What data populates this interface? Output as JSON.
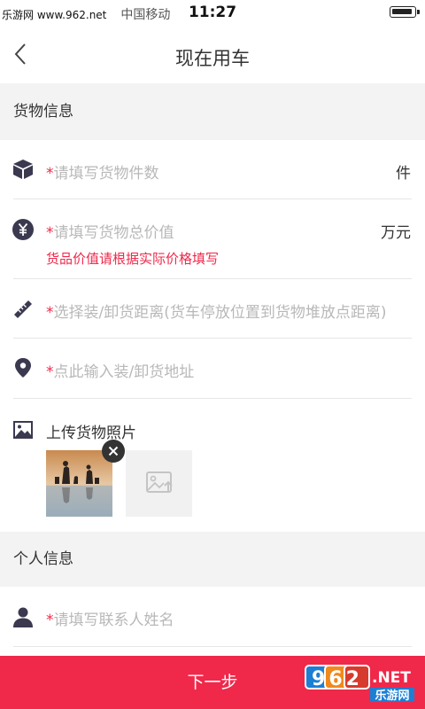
{
  "status_bar": {
    "watermark": "乐游网 www.962.net",
    "carrier": "中国移动",
    "time": "11:27"
  },
  "nav": {
    "title": "现在用车"
  },
  "sections": {
    "cargo_header": "货物信息",
    "personal_header": "个人信息"
  },
  "cargo": {
    "count": {
      "required_mark": "*",
      "placeholder": "请填写货物件数",
      "unit": "件",
      "icon": "box-icon"
    },
    "value": {
      "required_mark": "*",
      "placeholder": "请填写货物总价值",
      "unit": "万元",
      "hint": "货品价值请根据实际价格填写",
      "icon": "yuan-icon"
    },
    "distance": {
      "required_mark": "*",
      "placeholder": "选择装/卸货距离(货车停放位置到货物堆放点距离)",
      "icon": "ruler-icon"
    },
    "address": {
      "required_mark": "*",
      "placeholder": "点此输入装/卸货地址",
      "icon": "location-pin-icon"
    },
    "photos": {
      "label": "上传货物照片",
      "icon": "image-icon"
    }
  },
  "personal": {
    "contact_name": {
      "required_mark": "*",
      "placeholder": "请填写联系人姓名",
      "icon": "person-icon"
    }
  },
  "footer": {
    "next_label": "下一步",
    "logo_number": "962",
    "logo_suffix": ".NET",
    "logo_caption": "乐游网"
  },
  "colors": {
    "accent": "#f0284a",
    "section_bg": "#f3f3f3",
    "placeholder": "#b8b8b8",
    "icon": "#3a3950"
  }
}
